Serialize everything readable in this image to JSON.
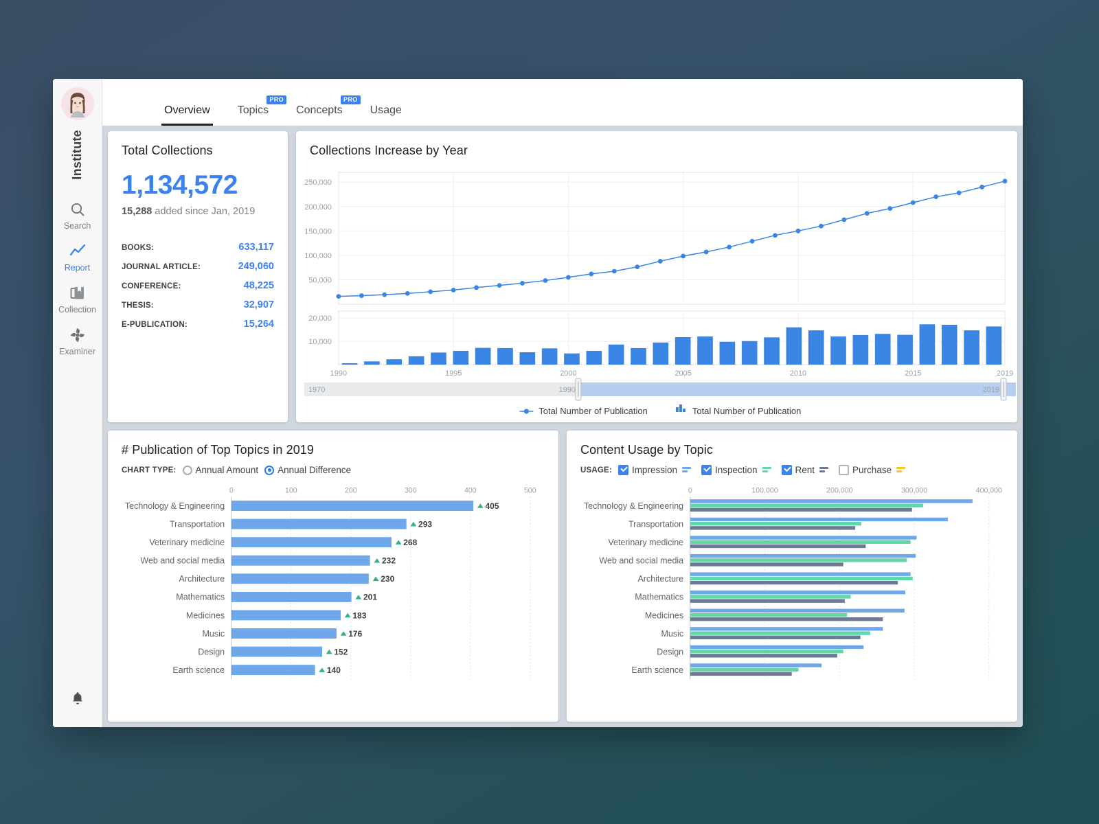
{
  "colors": {
    "accent": "#3b82ee",
    "line": "#3a85e3",
    "bar": "#3a85e3",
    "bar_light": "#6fa8ea",
    "impression": "#6fa8ea",
    "inspection": "#63d6aa",
    "rent": "#6c7a94",
    "purchase": "#f7c325",
    "up_arrow": "#34b37e",
    "page_bg": "#37506a"
  },
  "sidebar": {
    "brand": "Institute",
    "avatar_name": "user-avatar",
    "items": [
      {
        "label": "Search",
        "icon": "search-icon",
        "active": false
      },
      {
        "label": "Report",
        "icon": "report-line-icon",
        "active": true
      },
      {
        "label": "Collection",
        "icon": "collection-icon",
        "active": false
      },
      {
        "label": "Examiner",
        "icon": "examiner-icon",
        "active": false
      }
    ],
    "bell_icon": "notification-bell-icon"
  },
  "tabs": [
    {
      "label": "Overview",
      "badge": null,
      "active": true
    },
    {
      "label": "Topics",
      "badge": "PRO",
      "active": false
    },
    {
      "label": "Concepts",
      "badge": "PRO",
      "active": false
    },
    {
      "label": "Usage",
      "badge": null,
      "active": false
    }
  ],
  "total_collections": {
    "title": "Total Collections",
    "value": "1,134,572",
    "added_value": "15,288",
    "added_suffix": "added since Jan, 2019",
    "breakdown": [
      {
        "key": "BOOKS:",
        "value": "633,117"
      },
      {
        "key": "JOURNAL ARTICLE:",
        "value": "249,060"
      },
      {
        "key": "CONFERENCE:",
        "value": "48,225"
      },
      {
        "key": "THESIS:",
        "value": "32,907"
      },
      {
        "key": "E-PUBLICATION:",
        "value": "15,264"
      }
    ]
  },
  "chart_data": [
    {
      "id": "collections-increase-by-year",
      "type": "line",
      "title": "Collections Increase by Year",
      "xlabel": "",
      "ylabel": "",
      "grid": true,
      "legend_position": "bottom",
      "legend": [
        {
          "name": "Total Number of Publication",
          "marker": "line",
          "color": "#3a85e3"
        },
        {
          "name": "Total Number of Publication",
          "marker": "bars",
          "color": "#3a85e3"
        }
      ],
      "x_tick_labels": [
        "1990",
        "1995",
        "2000",
        "2005",
        "2010",
        "2015",
        "2019"
      ],
      "ylim": [
        0,
        270000
      ],
      "y_tick_labels": [
        "50,000",
        "100,000",
        "150,000",
        "200,000",
        "250,000"
      ],
      "y_ticks": [
        50000,
        100000,
        150000,
        200000,
        250000
      ],
      "x": [
        1990,
        1991,
        1992,
        1993,
        1994,
        1995,
        1996,
        1997,
        1998,
        1999,
        2000,
        2001,
        2002,
        2003,
        2004,
        2005,
        2006,
        2007,
        2008,
        2009,
        2010,
        2011,
        2012,
        2013,
        2014,
        2015,
        2016,
        2017,
        2018,
        2019
      ],
      "series": [
        {
          "name": "Total Number of Publication",
          "type": "line",
          "values": [
            16000,
            17500,
            19500,
            22000,
            25500,
            29000,
            34000,
            38500,
            43000,
            48500,
            55000,
            62000,
            67500,
            76500,
            88000,
            98500,
            107000,
            117000,
            129000,
            141000,
            150000,
            160000,
            173000,
            186000,
            196000,
            208000,
            220000,
            228000,
            240000,
            252000
          ]
        }
      ],
      "panel2": {
        "type": "bar",
        "title": "",
        "ylim": [
          0,
          23000
        ],
        "y_tick_labels": [
          "10,000",
          "20,000"
        ],
        "y_ticks": [
          10000,
          20000
        ],
        "name": "Total Number of Publication",
        "values": [
          600,
          1400,
          2300,
          3600,
          5200,
          5900,
          7200,
          7100,
          5300,
          7000,
          4800,
          5900,
          8600,
          7100,
          9500,
          11800,
          12100,
          9800,
          10100,
          11700,
          16000,
          14700,
          12100,
          12700,
          13200,
          12800,
          17300,
          17100,
          14700,
          16400
        ]
      },
      "range_slider": {
        "min_label": "1970",
        "max_label": "2019",
        "selected_start_label": "1990",
        "selected_end_label": "2019",
        "handle_left_pct": 38.5,
        "handle_right_pct": 100
      }
    },
    {
      "id": "publication-of-top-topics",
      "type": "bar",
      "orientation": "horizontal",
      "title": "# Publication of Top Topics in 2019",
      "chart_type_label": "CHART TYPE:",
      "options": [
        {
          "label": "Annual Amount",
          "selected": false
        },
        {
          "label": "Annual Difference",
          "selected": true
        }
      ],
      "xlabel": "",
      "ylabel": "",
      "xlim": [
        0,
        500
      ],
      "x_tick_labels": [
        "0",
        "100",
        "200",
        "300",
        "400",
        "500"
      ],
      "x_ticks": [
        0,
        100,
        200,
        300,
        400,
        500
      ],
      "grid": true,
      "categories": [
        "Technology & Engineering",
        "Transportation",
        "Veterinary medicine",
        "Web and social media",
        "Architecture",
        "Mathematics",
        "Medicines",
        "Music",
        "Design",
        "Earth science"
      ],
      "values": [
        405,
        293,
        268,
        232,
        230,
        201,
        183,
        176,
        152,
        140
      ],
      "value_labels": [
        "405",
        "293",
        "268",
        "232",
        "230",
        "201",
        "183",
        "176",
        "152",
        "140"
      ],
      "trend": [
        "up",
        "up",
        "up",
        "up",
        "up",
        "up",
        "up",
        "up",
        "up",
        "up"
      ]
    },
    {
      "id": "content-usage-by-topic",
      "type": "bar",
      "orientation": "horizontal",
      "title": "Content Usage by Topic",
      "usage_label": "USAGE:",
      "filters": [
        {
          "label": "Impression",
          "checked": true,
          "color": "#6fa8ea"
        },
        {
          "label": "Inspection",
          "checked": true,
          "color": "#63d6aa"
        },
        {
          "label": "Rent",
          "checked": true,
          "color": "#6c7a94"
        },
        {
          "label": "Purchase",
          "checked": false,
          "color": "#f7c325"
        }
      ],
      "xlim": [
        0,
        400000
      ],
      "x_tick_labels": [
        "0",
        "100,000",
        "200,000",
        "300,000",
        "400,000"
      ],
      "x_ticks": [
        0,
        100000,
        200000,
        300000,
        400000
      ],
      "grid": true,
      "categories": [
        "Technology & Engineering",
        "Transportation",
        "Veterinary medicine",
        "Web and social media",
        "Architecture",
        "Mathematics",
        "Medicines",
        "Music",
        "Design",
        "Earth science"
      ],
      "series": [
        {
          "name": "Impression",
          "color": "#6fa8ea",
          "values": [
            378000,
            345000,
            303000,
            302000,
            295000,
            288000,
            287000,
            258000,
            232000,
            176000
          ]
        },
        {
          "name": "Inspection",
          "color": "#63d6aa",
          "values": [
            312000,
            229000,
            295000,
            290000,
            298000,
            215000,
            210000,
            241000,
            205000,
            145000
          ]
        },
        {
          "name": "Rent",
          "color": "#6c7a94",
          "values": [
            297000,
            221000,
            235000,
            205000,
            278000,
            207000,
            258000,
            228000,
            197000,
            136000
          ]
        }
      ]
    }
  ]
}
